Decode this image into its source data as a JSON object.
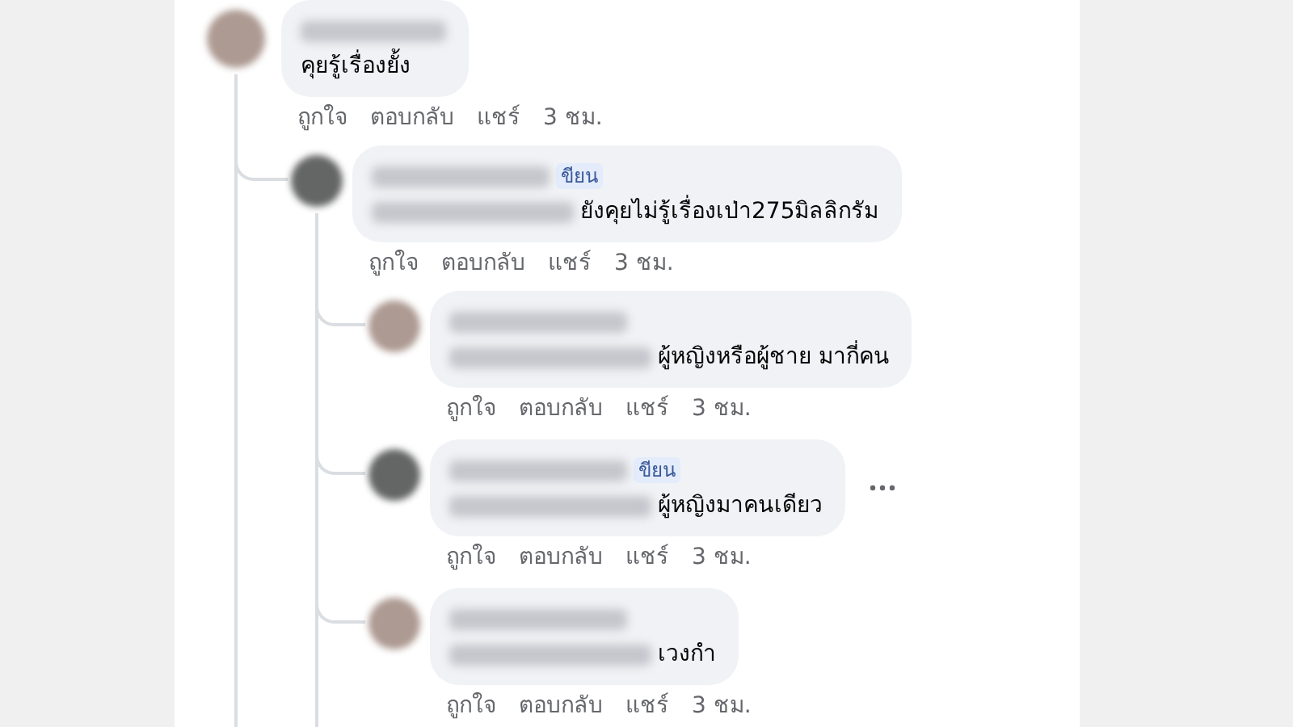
{
  "thread": [
    {
      "avatar": {
        "kind": "light"
      },
      "redacted_name": true,
      "text": "คุยรู้เรื่องยั้ง",
      "actions": [
        "ถูกใจ",
        "ตอบกลับ",
        "แชร์"
      ],
      "time": "3 ชม.",
      "children": [
        {
          "avatar": {
            "kind": "dark"
          },
          "redacted_name": true,
          "tag": "ขียน",
          "redacted_quote": true,
          "text": "ยังคุยไม่รู้เรื่องเป่า275มิลลิกรัม",
          "actions": [
            "ถูกใจ",
            "ตอบกลับ",
            "แชร์"
          ],
          "time": "3 ชม.",
          "children": [
            {
              "avatar": {
                "kind": "light"
              },
              "redacted_name": true,
              "redacted_quote": true,
              "text": "ผู้หญิงหรือผู้ชาย มากี่คน",
              "actions": [
                "ถูกใจ",
                "ตอบกลับ",
                "แชร์"
              ],
              "time": "3 ชม."
            },
            {
              "avatar": {
                "kind": "dark"
              },
              "redacted_name": true,
              "tag": "ขียน",
              "redacted_quote": true,
              "text": "ผู้หญิงมาคนเดียว",
              "actions": [
                "ถูกใจ",
                "ตอบกลับ",
                "แชร์"
              ],
              "time": "3 ชม.",
              "more": true
            },
            {
              "avatar": {
                "kind": "light"
              },
              "redacted_name": true,
              "redacted_quote": true,
              "text": "เวงกำ",
              "actions": [
                "ถูกใจ",
                "ตอบกลับ",
                "แชร์"
              ],
              "time": "3 ชม."
            }
          ]
        }
      ]
    }
  ]
}
